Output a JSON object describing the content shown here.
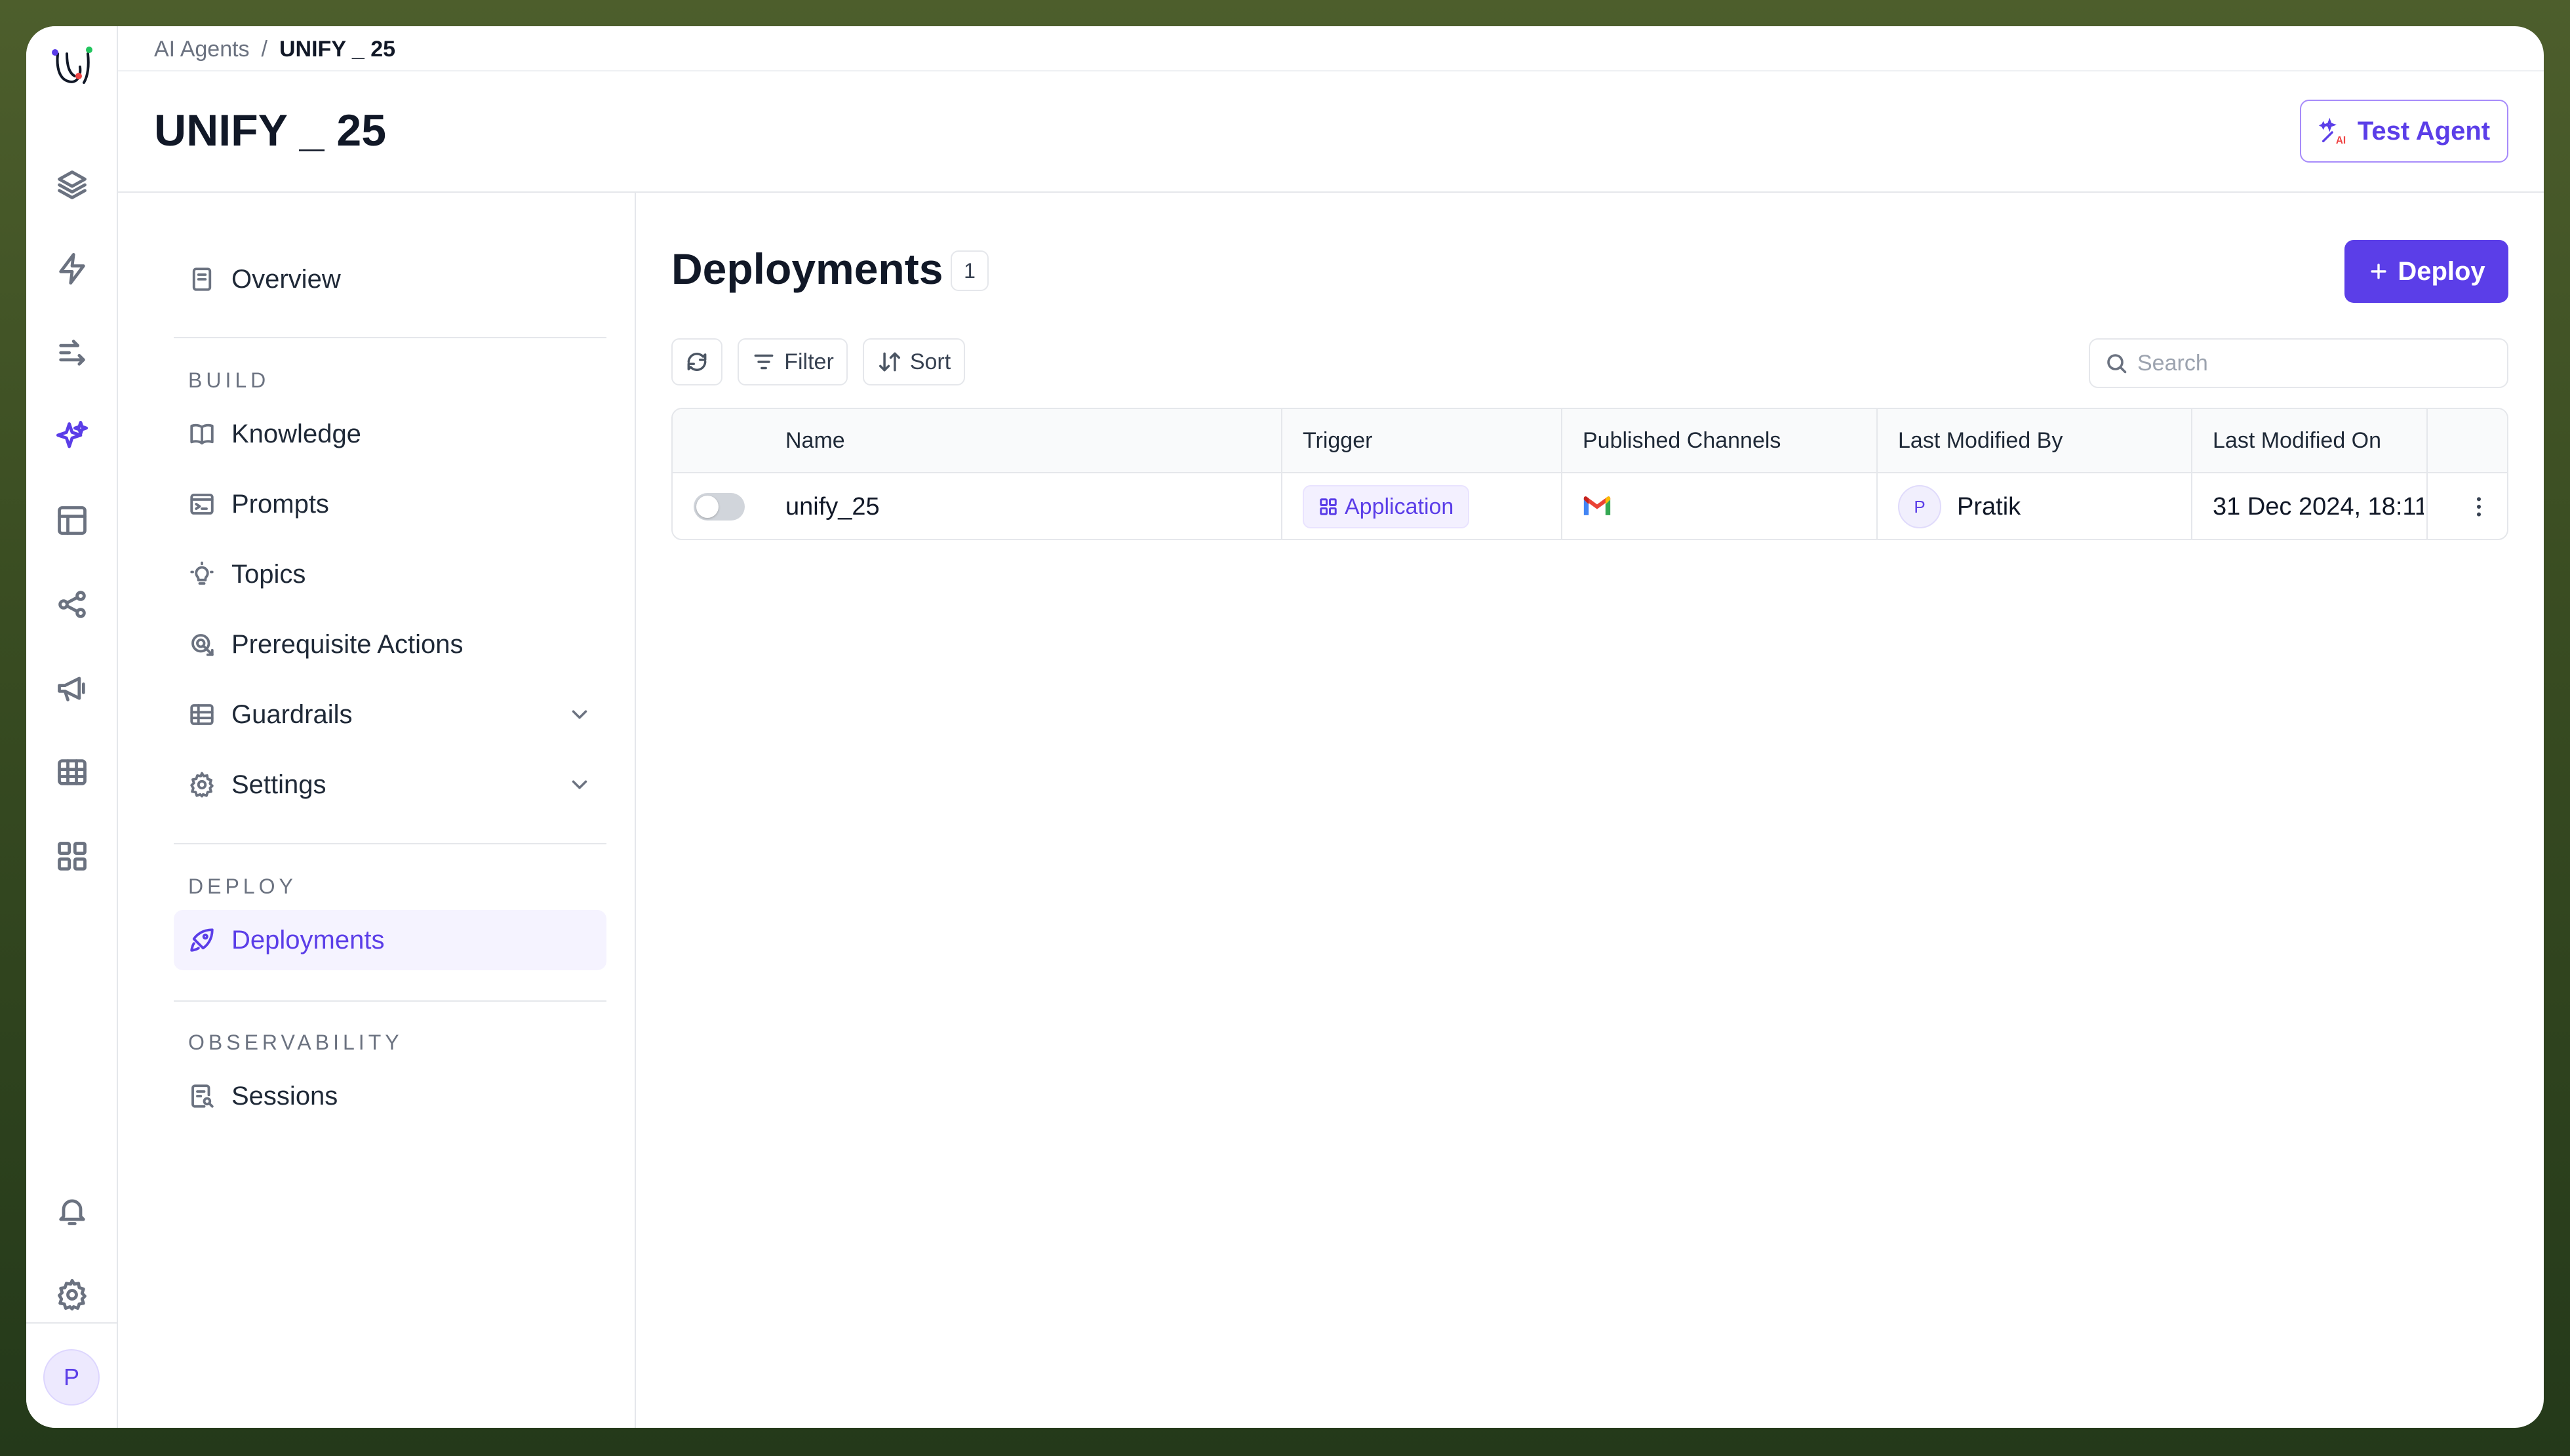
{
  "breadcrumb": {
    "parent": "AI Agents",
    "separator": "/",
    "current": "UNIFY _ 25"
  },
  "page": {
    "title": "UNIFY _ 25",
    "test_agent_label": "Test Agent"
  },
  "rail": {
    "items": [
      "layers-icon",
      "bolt-icon",
      "flow-icon",
      "sparkle-icon",
      "layout-icon",
      "share-icon",
      "megaphone-icon",
      "table-icon",
      "grid-icon",
      "bell-icon",
      "gear-icon"
    ],
    "active": "sparkle-icon",
    "avatar": "P"
  },
  "sidebar": {
    "overview": "Overview",
    "build_label": "BUILD",
    "build_items": [
      "Knowledge",
      "Prompts",
      "Topics",
      "Prerequisite Actions",
      "Guardrails",
      "Settings"
    ],
    "deploy_label": "DEPLOY",
    "deploy_items": [
      "Deployments"
    ],
    "observability_label": "OBSERVABILITY",
    "observability_items": [
      "Sessions"
    ],
    "active": "Deployments"
  },
  "main": {
    "title": "Deployments",
    "count": "1",
    "deploy_button": "Deploy",
    "toolbar": {
      "filter": "Filter",
      "sort": "Sort"
    },
    "search": {
      "placeholder": "Search",
      "value": ""
    }
  },
  "table": {
    "columns": [
      "Name",
      "Trigger",
      "Published Channels",
      "Last Modified By",
      "Last Modified On"
    ],
    "rows": [
      {
        "enabled": false,
        "name": "unify_25",
        "trigger": "Application",
        "channel_icon": "gmail-icon",
        "modified_by_initial": "P",
        "modified_by": "Pratik",
        "modified_on": "31 Dec 2024, 18:11"
      }
    ]
  },
  "colors": {
    "accent": "#5b3ee8",
    "accent_light": "#f5f3ff",
    "border": "#e5e7eb"
  }
}
